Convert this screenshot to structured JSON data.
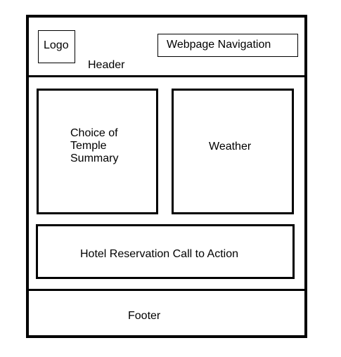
{
  "header": {
    "logo_label": "Logo",
    "title": "Header",
    "nav_label": "Webpage Navigation"
  },
  "main": {
    "temple_summary_lines": [
      "Choice of",
      "Temple",
      "Summary"
    ],
    "weather_label": "Weather",
    "hotel_cta_label": "Hotel Reservation Call to Action"
  },
  "footer": {
    "label": "Footer"
  }
}
